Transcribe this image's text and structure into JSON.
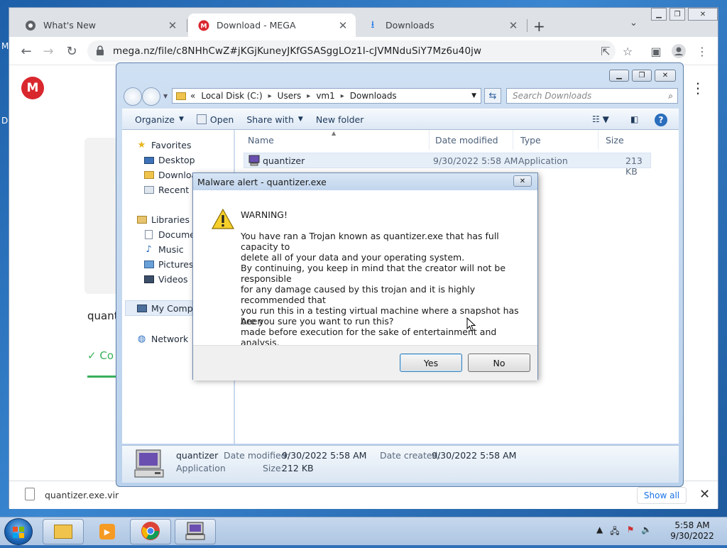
{
  "desktop": {
    "edge_chars": [
      "M",
      "D"
    ]
  },
  "chrome": {
    "tabs": [
      {
        "title": "What's New",
        "icon": "chrome-icon"
      },
      {
        "title": "Download - MEGA",
        "icon": "mega-icon"
      },
      {
        "title": "Downloads",
        "icon": "download-icon"
      }
    ],
    "url": "mega.nz/file/c8NHhCwZ#jKGjKuneyJKfGSASggLOz1I-cJVMNduSiY7Mz6u40jw",
    "page": {
      "logo": "M",
      "file_name_partial": "quant",
      "status_partial": "Co"
    },
    "downloads_bar": {
      "file": "quantizer.exe.vir",
      "show_all": "Show all"
    }
  },
  "explorer": {
    "breadcrumb": [
      "Local Disk (C:)",
      "Users",
      "vm1",
      "Downloads"
    ],
    "breadcrumb_prefix": "«",
    "search_placeholder": "Search Downloads",
    "commands": {
      "organize": "Organize",
      "open": "Open",
      "share_with": "Share with",
      "new_folder": "New folder"
    },
    "nav": {
      "favorites": "Favorites",
      "desktop": "Desktop",
      "downloads": "Downloa",
      "recent": "Recent Pl",
      "libraries": "Libraries",
      "documents": "Documen",
      "music": "Music",
      "pictures": "Pictures",
      "videos": "Videos",
      "computer": "My Compu",
      "network": "Network"
    },
    "columns": {
      "name": "Name",
      "date": "Date modified",
      "type": "Type",
      "size": "Size"
    },
    "files": [
      {
        "name": "quantizer",
        "date": "9/30/2022 5:58 AM",
        "type": "Application",
        "size": "213 KB"
      }
    ],
    "details": {
      "name": "quantizer",
      "type": "Application",
      "date_modified_label": "Date modified:",
      "date_modified": "9/30/2022 5:58 AM",
      "date_created_label": "Date created:",
      "date_created": "9/30/2022 5:58 AM",
      "size_label": "Size:",
      "size": "212 KB"
    }
  },
  "dialog": {
    "title": "Malware alert - quantizer.exe",
    "heading": "WARNING!",
    "para1": "You have ran a Trojan known as quantizer.exe that has full capacity to\ndelete all of your data and your operating system.",
    "para2": "By continuing, you keep in mind that the creator will not be responsible\nfor any damage caused by this trojan and it is highly recommended that\nyou run this in a testing virtual machine where a snapshot has been\nmade before execution for the sake of entertainment and analysis.",
    "question": "Are you sure you want to run this?",
    "yes": "Yes",
    "no": "No"
  },
  "taskbar": {
    "time": "5:58 AM",
    "date": "9/30/2022"
  },
  "colors": {
    "mega_red": "#d9272e",
    "success_green": "#37b05b",
    "win7_blue": "#2f6fb8"
  }
}
